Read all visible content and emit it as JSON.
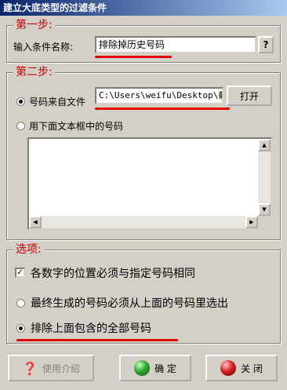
{
  "window": {
    "title": "建立大底类型的过滤条件"
  },
  "step1": {
    "legend": "第一步:",
    "name_label": "输入条件名称:",
    "name_value": "排除掉历史号码",
    "help_label": "?"
  },
  "step2": {
    "legend": "第二步:",
    "from_file_label": "号码来自文件",
    "file_path": "C:\\Users\\weifu\\Desktop\\截i",
    "open_button": "打开",
    "from_text_label": "用下面文本框中的号码"
  },
  "options": {
    "legend": "选项:",
    "opt1": "各数字的位置必须与指定号码相同",
    "opt2": "最终生成的号码必须从上面的号码里选出",
    "opt3": "排除上面包含的全部号码"
  },
  "footer": {
    "intro_button": "使用介绍",
    "ok_button": "确 定",
    "close_button": "关 闭"
  },
  "colors": {
    "title_gradient_start": "#0a246a",
    "legend_red": "#c00000",
    "underline_red": "#e00000",
    "ok_green": "#2fa82f",
    "close_red": "#d62020"
  }
}
